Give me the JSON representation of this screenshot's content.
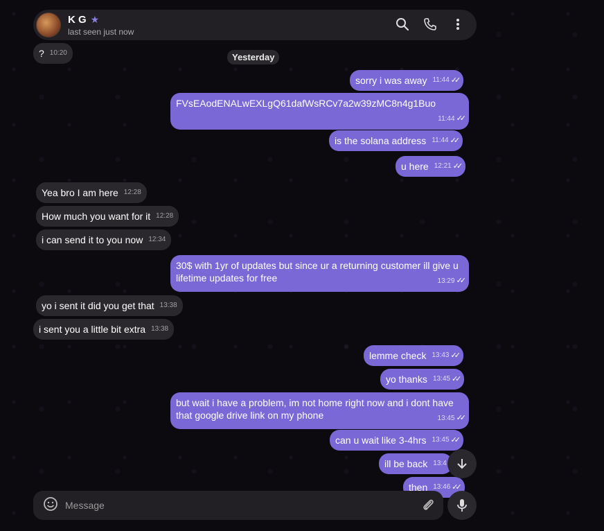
{
  "header": {
    "name": "K G",
    "status": "last seen just now",
    "verified_icon": "star-icon"
  },
  "date_separator": "Yesterday",
  "messages": [
    {
      "dir": "in",
      "text": "?",
      "time": "10:20"
    },
    {
      "dir": "out",
      "text": "sorry i was away",
      "time": "11:44"
    },
    {
      "dir": "out",
      "text": "FVsEAodENALwEXLgQ61dafWsRCv7a2w39zMC8n4g1Buo",
      "time": "11:44"
    },
    {
      "dir": "out",
      "text": "is the solana address",
      "time": "11:44"
    },
    {
      "dir": "out",
      "text": "u here",
      "time": "12:21"
    },
    {
      "dir": "in",
      "text": "Yea bro I am here",
      "time": "12:28"
    },
    {
      "dir": "in",
      "text": "How much you want for it",
      "time": "12:28"
    },
    {
      "dir": "in",
      "text": "i can send it to you now",
      "time": "12:34"
    },
    {
      "dir": "out",
      "text": "30$ with 1yr of updates but since ur a returning customer ill give u lifetime updates for free",
      "time": "13:29"
    },
    {
      "dir": "in",
      "text": "yo i sent it did you get that",
      "time": "13:38"
    },
    {
      "dir": "in",
      "text": "i sent you a little bit extra",
      "time": "13:38"
    },
    {
      "dir": "out",
      "text": "lemme check",
      "time": "13:43"
    },
    {
      "dir": "out",
      "text": "yo thanks",
      "time": "13:45"
    },
    {
      "dir": "out",
      "text": "but wait i have a problem, im not home right now and i dont have that google drive link on my phone",
      "time": "13:45"
    },
    {
      "dir": "out",
      "text": "can u wait like 3-4hrs",
      "time": "13:45"
    },
    {
      "dir": "out",
      "text": "ill be back",
      "time": "13:4"
    },
    {
      "dir": "out",
      "text": "then",
      "time": "13:46"
    }
  ],
  "composer": {
    "placeholder": "Message"
  }
}
